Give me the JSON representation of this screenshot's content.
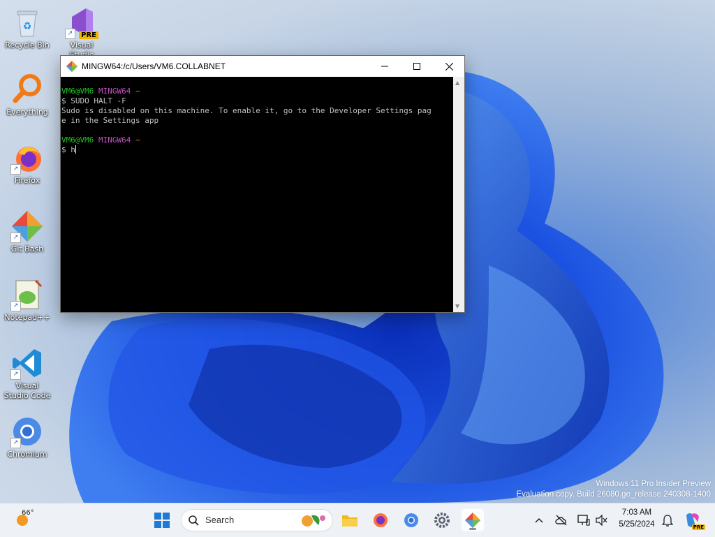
{
  "desktop": {
    "icons": [
      {
        "label": "Recycle Bin"
      },
      {
        "label": "Visual Studio",
        "badge": "PRE"
      },
      {
        "label": "Everything"
      },
      {
        "label": "Firefox"
      },
      {
        "label": "Git Bash"
      },
      {
        "label": "Notepad++"
      },
      {
        "label": "Visual Studio Code"
      },
      {
        "label": "Chromium"
      }
    ]
  },
  "terminal": {
    "title": "MINGW64:/c/Users/VM6.COLLABNET",
    "lines": {
      "prompt1_user": "VM6@VM6",
      "prompt1_env": "MINGW64",
      "prompt1_path": "~",
      "cmd1": "$ SUDO HALT -F",
      "out1": "Sudo is disabled on this machine. To enable it, go to the Developer Settings pag",
      "out2": "e in the Settings app",
      "prompt2_user": "VM6@VM6",
      "prompt2_env": "MINGW64",
      "prompt2_path": "~",
      "cmd2": "$ h"
    }
  },
  "watermark": {
    "line1": "Windows 11 Pro Insider Preview",
    "line2": "Evaluation copy. Build 26080.ge_release.240308-1400"
  },
  "taskbar": {
    "weather": "66°",
    "search_placeholder": "Search",
    "time": "7:03 AM",
    "date": "5/25/2024",
    "copilot_badge": "PRE"
  },
  "colors": {
    "prompt_user": "#1fc41f",
    "prompt_env": "#c24fc2",
    "prompt_path": "#c4a000",
    "terminal_bg": "#000000"
  }
}
